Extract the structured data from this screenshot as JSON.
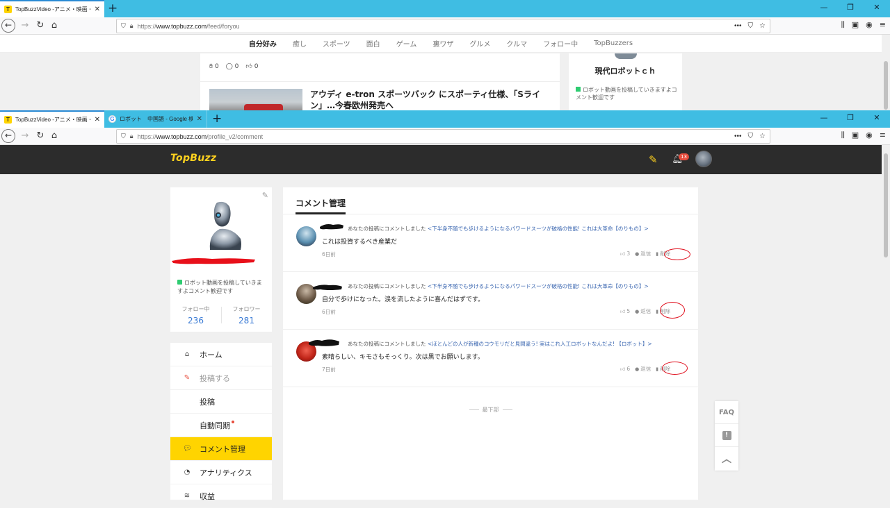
{
  "colors": {
    "accent": "#ffd400",
    "tab_bar": "#3fbde3",
    "link": "#3a66b0",
    "stat": "#3a7bd5",
    "red_mark": "#e0101e"
  },
  "back_window": {
    "tabs": [
      {
        "icon": "topbuzz-favicon",
        "label": "TopBuzzVideo -アニメ・映画・音"
      }
    ],
    "url": {
      "protocol": "https://",
      "host": "www.topbuzz.com",
      "path": "/feed/foryou"
    },
    "categories": [
      "自分好み",
      "癒し",
      "スポーツ",
      "面白",
      "ゲーム",
      "裏ワザ",
      "グルメ",
      "クルマ",
      "フォロー中",
      "TopBuzzers"
    ],
    "reaction_counts": [
      "0",
      "0",
      "0"
    ],
    "article_title": "アウディ e-tron スポーツバック にスポーティ仕様、「Sライン」…今春欧州発売へ",
    "side_channel_name": "現代ロボットｃｈ",
    "side_channel_bio": "ロボット動画を投稿していきますよコメント歓迎です"
  },
  "front_window": {
    "tabs": [
      {
        "icon": "topbuzz-favicon",
        "label": "TopBuzzVideo -アニメ・映画・音"
      },
      {
        "icon": "google-favicon",
        "label": "ロボット　中国語 - Google 検索"
      }
    ],
    "url": {
      "protocol": "https://",
      "host": "www.topbuzz.com",
      "path": "/profile_v2/comment"
    }
  },
  "header": {
    "logo": "TopBuzz",
    "notification_count": "13"
  },
  "profile": {
    "bio": "ロボット動画を投稿していきますよコメント歓迎です",
    "following_label": "フォロー中",
    "following_count": "236",
    "followers_label": "フォロワー",
    "followers_count": "281"
  },
  "menu": [
    {
      "icon": "home-icon",
      "label": "ホーム"
    },
    {
      "icon": "pencil-icon",
      "label": "投稿する"
    },
    {
      "label": "投稿"
    },
    {
      "label": "自動同期"
    },
    {
      "icon": "comment-icon",
      "label": "コメント管理"
    },
    {
      "icon": "analytics-icon",
      "label": "アナリティクス"
    },
    {
      "icon": "coins-icon",
      "label": "収益"
    }
  ],
  "main": {
    "heading": "コメント管理",
    "comments": [
      {
        "prefix": "あなたの投稿にコメントしました",
        "post_title": "<下半身不随でも歩けるようになるパワードスーツが破格の性能! これは大革命【のりもの】>",
        "text": "これは投資するべき産業だ",
        "date": "6日前",
        "likes": "3",
        "reply": "返信",
        "delete": "削除"
      },
      {
        "prefix": "あなたの投稿にコメントしました",
        "post_title": "<下半身不随でも歩けるようになるパワードスーツが破格の性能! これは大革命【のりもの】>",
        "text": "自分で歩けになった。涙を流したように喜んだはずです。",
        "date": "6日前",
        "likes": "5",
        "reply": "返信",
        "delete": "削除"
      },
      {
        "prefix": "あなたの投稿にコメントしました",
        "post_title": "<ほとんどの人が新種のコウモリだと見間違う! 実はこれ人工ロボットなんだよ! 【ロボット】>",
        "text": "素晴らしい、キモさもそっくり。次は黒でお願いします。",
        "date": "7日前",
        "likes": "6",
        "reply": "返信",
        "delete": "削除"
      }
    ],
    "end_label": "最下部"
  },
  "side_tools": {
    "faq": "FAQ"
  }
}
